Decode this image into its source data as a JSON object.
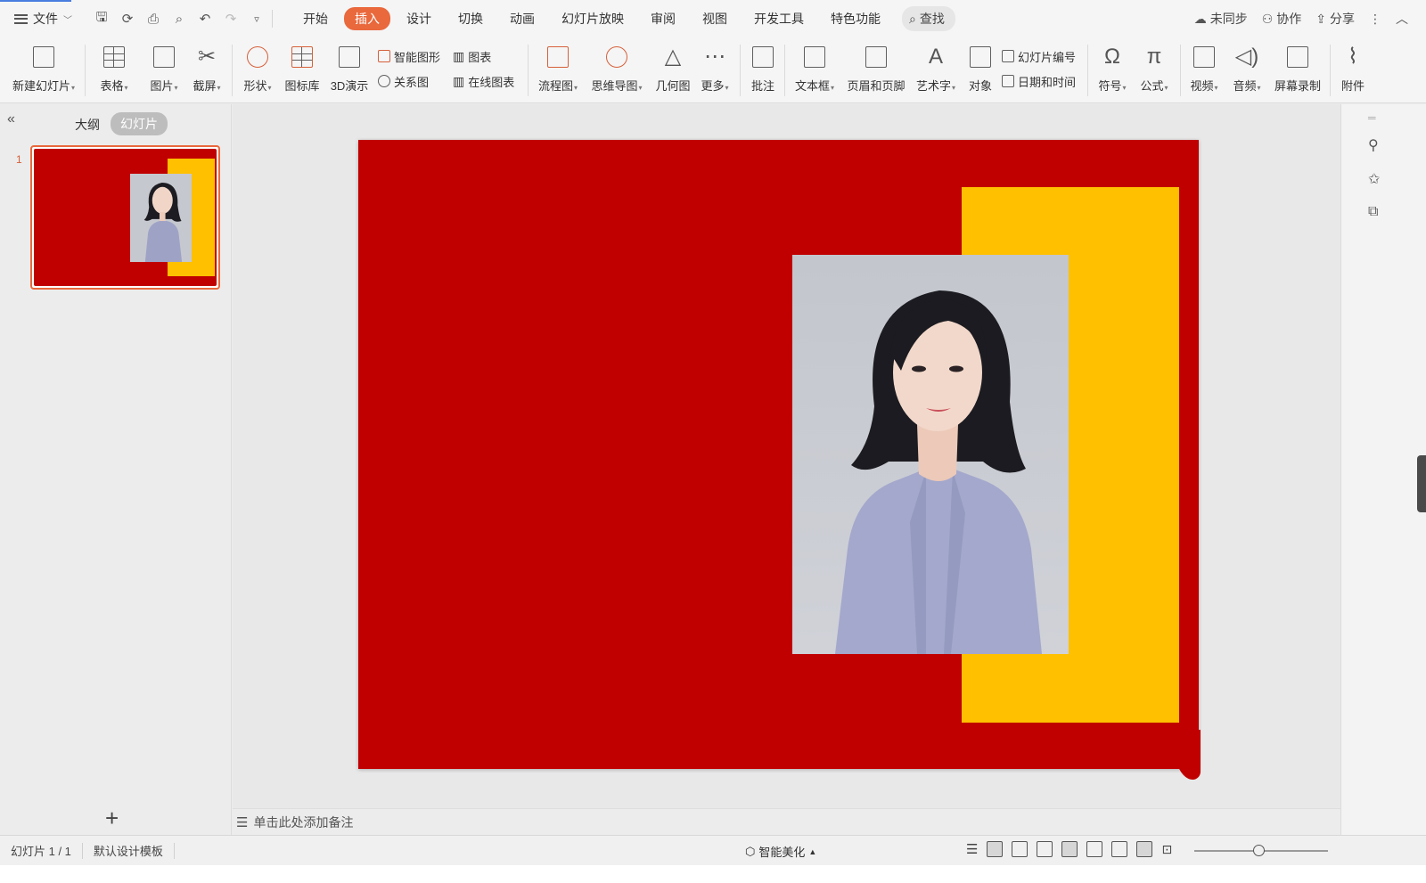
{
  "menu": {
    "file": "文件"
  },
  "tabs": [
    {
      "label": "开始",
      "active": false
    },
    {
      "label": "插入",
      "active": true
    },
    {
      "label": "设计",
      "active": false
    },
    {
      "label": "切换",
      "active": false
    },
    {
      "label": "动画",
      "active": false
    },
    {
      "label": "幻灯片放映",
      "active": false
    },
    {
      "label": "审阅",
      "active": false
    },
    {
      "label": "视图",
      "active": false
    },
    {
      "label": "开发工具",
      "active": false
    },
    {
      "label": "特色功能",
      "active": false
    }
  ],
  "search_label": "查找",
  "top_right": {
    "unsynced": "未同步",
    "collab": "协作",
    "share": "分享"
  },
  "ribbon": {
    "new_slide": "新建幻灯片",
    "table": "表格",
    "picture": "图片",
    "screenshot": "截屏",
    "shape": "形状",
    "icon_lib": "图标库",
    "demo3d": "3D演示",
    "smart_shape": "智能图形",
    "chart": "图表",
    "relation": "关系图",
    "online_chart": "在线图表",
    "flowchart": "流程图",
    "mindmap": "思维导图",
    "geometry": "几何图",
    "more": "更多",
    "comment": "批注",
    "textbox": "文本框",
    "header_footer": "页眉和页脚",
    "wordart": "艺术字",
    "object": "对象",
    "slide_number": "幻灯片编号",
    "date_time": "日期和时间",
    "symbol": "符号",
    "formula": "公式",
    "video": "视频",
    "audio": "音频",
    "screen_record": "屏幕录制",
    "attachment": "附件"
  },
  "left_panel": {
    "outline_tab": "大纲",
    "slides_tab": "幻灯片",
    "slide_number": "1"
  },
  "notes_placeholder": "单击此处添加备注",
  "status": {
    "slide_info": "幻灯片 1 / 1",
    "template": "默认设计模板",
    "smart_beautify": "智能美化"
  },
  "slide_colors": {
    "background": "#C00000",
    "accent_block": "#FFC000",
    "tab_active": "#E9683C"
  }
}
